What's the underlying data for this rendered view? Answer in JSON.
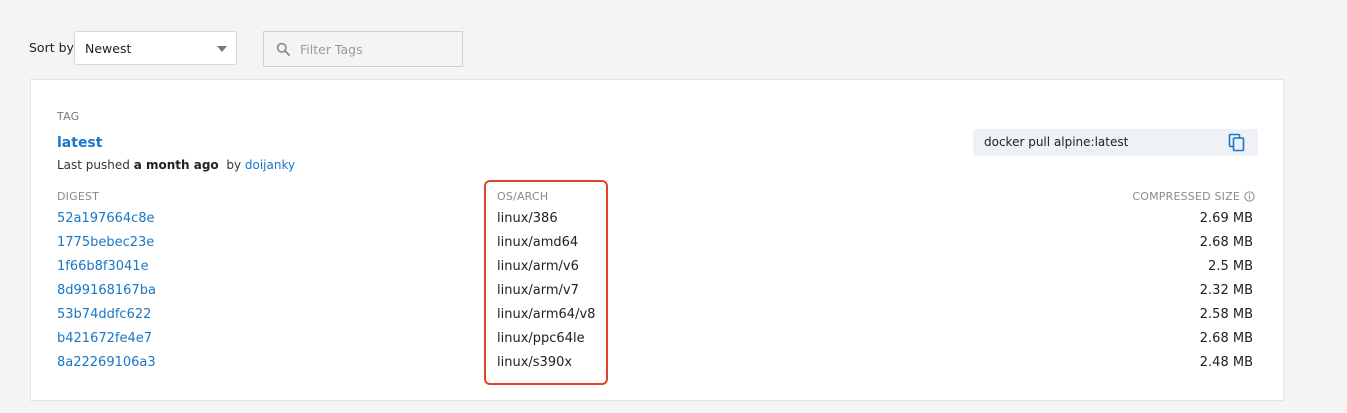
{
  "toolbar": {
    "sort_label": "Sort by",
    "sort_value": "Newest",
    "filter_placeholder": "Filter Tags"
  },
  "tag": {
    "section_label": "TAG",
    "name": "latest",
    "pushed_prefix": "Last pushed",
    "pushed_time": "a month ago",
    "pushed_by_label": "by",
    "pushed_by_user": "doijanky",
    "pull_command": "docker pull alpine:latest"
  },
  "table": {
    "headers": {
      "digest": "DIGEST",
      "os_arch": "OS/ARCH",
      "compressed_size": "COMPRESSED SIZE"
    },
    "rows": [
      {
        "digest": "52a197664c8e",
        "os_arch": "linux/386",
        "size": "2.69 MB"
      },
      {
        "digest": "1775bebec23e",
        "os_arch": "linux/amd64",
        "size": "2.68 MB"
      },
      {
        "digest": "1f66b8f3041e",
        "os_arch": "linux/arm/v6",
        "size": "2.5 MB"
      },
      {
        "digest": "8d99168167ba",
        "os_arch": "linux/arm/v7",
        "size": "2.32 MB"
      },
      {
        "digest": "53b74ddfc622",
        "os_arch": "linux/arm64/v8",
        "size": "2.58 MB"
      },
      {
        "digest": "b421672fe4e7",
        "os_arch": "linux/ppc64le",
        "size": "2.68 MB"
      },
      {
        "digest": "8a22269106a3",
        "os_arch": "linux/s390x",
        "size": "2.48 MB"
      }
    ]
  },
  "colors": {
    "link": "#1a76c6",
    "highlight_border": "#e0452c",
    "pull_box_bg": "#eef1f5"
  },
  "icons": {
    "search": "search-icon",
    "copy": "copy-icon",
    "info": "info-icon",
    "dropdown": "chevron-down-icon"
  }
}
